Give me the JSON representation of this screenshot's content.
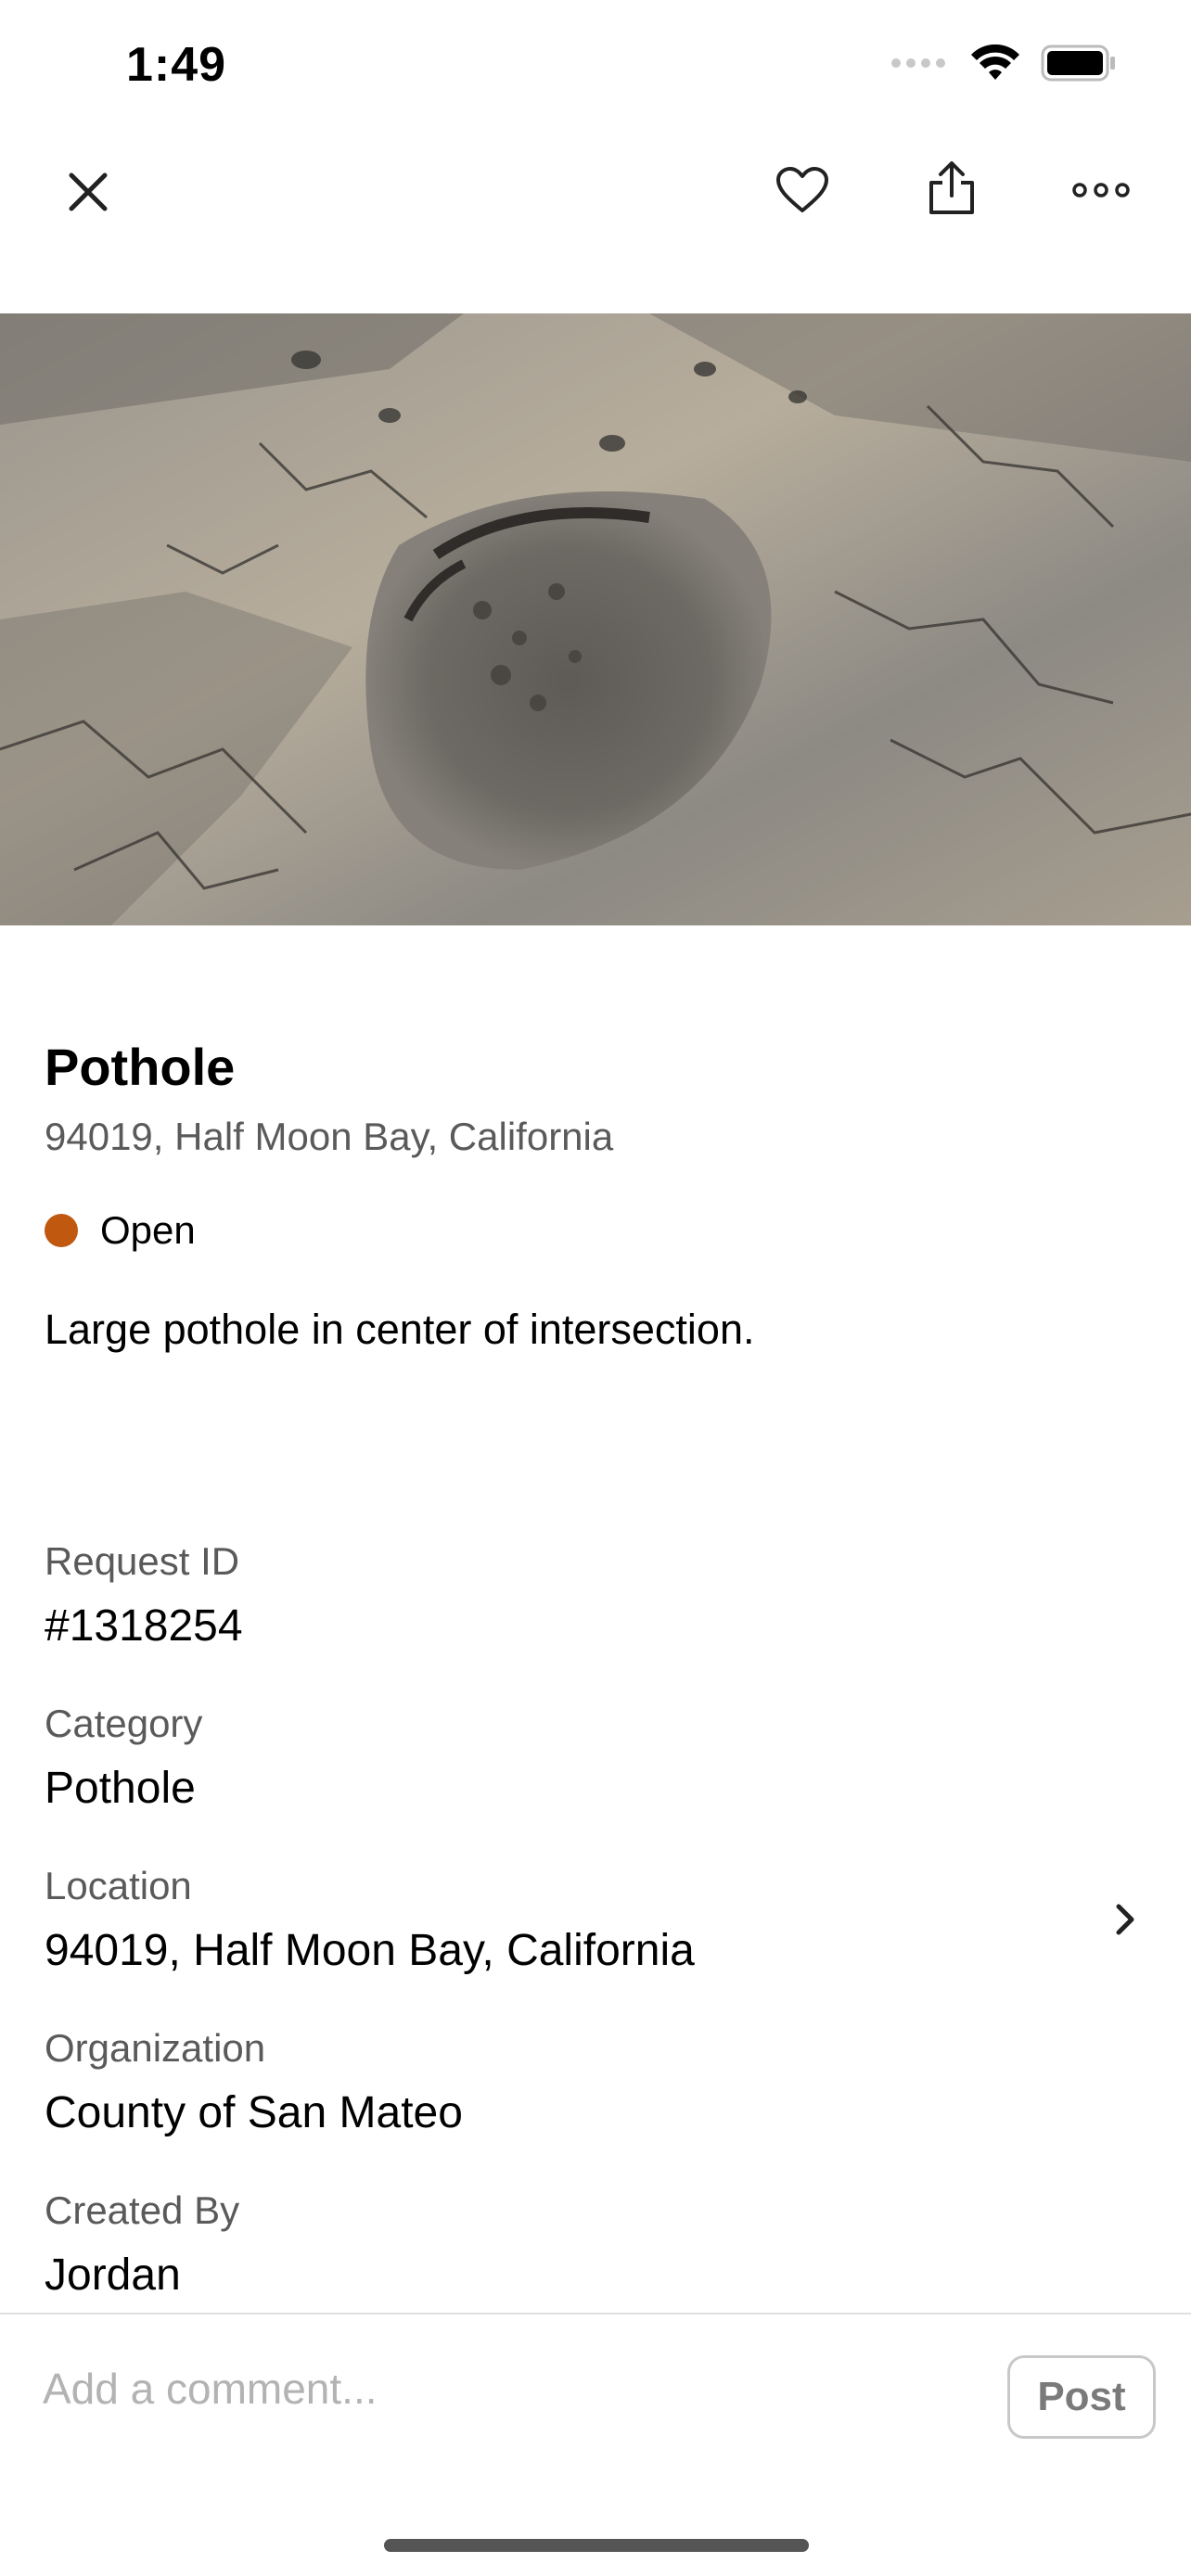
{
  "status_bar": {
    "time": "1:49"
  },
  "top_bar": {
    "close_icon": "close-icon",
    "favorite_icon": "heart-icon",
    "share_icon": "share-icon",
    "more_icon": "more-icon"
  },
  "hero": {
    "image": "pothole-photo"
  },
  "request": {
    "title": "Pothole",
    "subtitle": "94019, Half Moon Bay, California",
    "status": {
      "label": "Open",
      "color": "#c0580f"
    },
    "description": "Large pothole in center of intersection."
  },
  "fields": {
    "request_id": {
      "label": "Request ID",
      "value": "#1318254"
    },
    "category": {
      "label": "Category",
      "value": "Pothole"
    },
    "location": {
      "label": "Location",
      "value": "94019, Half Moon Bay, California"
    },
    "organization": {
      "label": "Organization",
      "value": "County of San Mateo"
    },
    "created_by": {
      "label": "Created By",
      "value": "Jordan"
    }
  },
  "comment": {
    "placeholder": "Add a comment...",
    "value": "",
    "post_label": "Post"
  }
}
